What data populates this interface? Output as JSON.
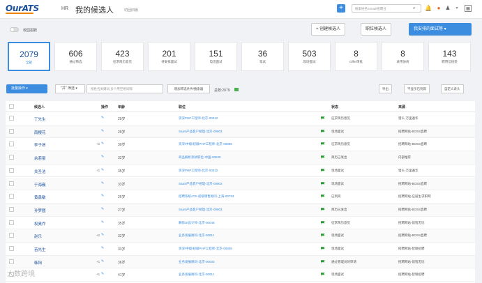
{
  "header": {
    "logo": "OurATS",
    "hr": "HR",
    "title": "我的候选人",
    "switch": "切回旧版",
    "search_placeholder": "搜索姓名/email/招聘台"
  },
  "toggle_label": "校园招聘",
  "buttons": {
    "create": "+ 创建候选人",
    "job": "职位候选人",
    "interview": "我安排的面试等 ▾"
  },
  "stats": [
    {
      "n": "2079",
      "l": "全部"
    },
    {
      "n": "606",
      "l": "通过筛选"
    },
    {
      "n": "423",
      "l": "征求简历意见"
    },
    {
      "n": "201",
      "l": "待安排面试"
    },
    {
      "n": "151",
      "l": "电话面试"
    },
    {
      "n": "36",
      "l": "笔试"
    },
    {
      "n": "503",
      "l": "现场面试"
    },
    {
      "n": "8",
      "l": "Offer审批"
    },
    {
      "n": "8",
      "l": "录用协商"
    },
    {
      "n": "143",
      "l": "聘用信接受"
    }
  ],
  "toolbar": {
    "bulk": "批量操作 ▾",
    "filter": "\"并\" 筛选 ▾",
    "filter_placeholder": "按姓名关键词,多个用空格间隔",
    "add_filter": "增加筛选条件/搜索器",
    "total": "总数:2079",
    "export": "导出",
    "no_show": "不显示已到岗",
    "custom": "自定义表头"
  },
  "columns": {
    "name": "候选人",
    "op": "操作",
    "age": "年龄",
    "job": "职位",
    "status": "状态",
    "source": "来源"
  },
  "rows": [
    {
      "name": "丁先生",
      "op": "",
      "age": "29岁",
      "job": "资深PHP工程师-北京-00012",
      "status": "征求简历意见",
      "src": "猎头-万里遍华"
    },
    {
      "name": "南樱花",
      "op": "",
      "age": "29岁",
      "job": "SaaS产品客户经理-北京-00903",
      "status": "现场面试",
      "src": "招聘网站-BOSS直聘"
    },
    {
      "name": "李子昂",
      "op": "+2",
      "age": "30岁",
      "job": "资深/中级/初级PHP工程师-北京-00808",
      "status": "征求简历意见",
      "src": "招聘网站-BOSS直聘"
    },
    {
      "name": "余若豪",
      "op": "",
      "age": "32岁",
      "job": "商品解析测试职位-中国-00830",
      "status": "简历已发出",
      "src": "内部推荐"
    },
    {
      "name": "关圣洁",
      "op": "+1",
      "age": "35岁",
      "job": "资深PHP工程师-北京-00012",
      "status": "现场面试",
      "src": "猎头-万里遍华"
    },
    {
      "name": "于海巍",
      "op": "",
      "age": "33岁",
      "job": "SaaS产品客户经理-北京-00903",
      "status": "现场面试",
      "src": "招聘网站-BOSS直聘"
    },
    {
      "name": "黄鑫敏",
      "op": "",
      "age": "26岁",
      "job": "招聘系统ATS-初级销售顾问-上海-00793",
      "status": "已到岗",
      "src": "招聘网站-应届生求职网"
    },
    {
      "name": "孙梦圆",
      "op": "",
      "age": "27岁",
      "job": "SaaS产品客户经理-北京-00903",
      "status": "简历已发出",
      "src": "招聘网站-BOSS直聘"
    },
    {
      "name": "权奥乔",
      "op": "",
      "age": "35岁",
      "job": "舞际UI设计师-北京-00048",
      "status": "征求简历意见",
      "src": "招聘网站-前程无忧"
    },
    {
      "name": "赵乐",
      "op": "+2",
      "age": "32岁",
      "job": "业务发展顾问-北京-00811",
      "status": "现场面试",
      "src": "招聘网站-BOSS直聘"
    },
    {
      "name": "苗先生",
      "op": "",
      "age": "33岁",
      "job": "资深/中级/初级PHP工程师-北京-00808",
      "status": "现场面试",
      "src": "招聘网站-智联招聘"
    },
    {
      "name": "韩阳",
      "op": "+1",
      "age": "36岁",
      "job": "业务发展顾问-北京-00003",
      "status": "通过管理员的审请",
      "src": "招聘网站-前程无忧"
    },
    {
      "name": "",
      "op": "+1",
      "age": "41岁",
      "job": "业务发展顾问-北京-00811",
      "status": "现场面试",
      "src": "招聘网站-智联招聘"
    }
  ],
  "watermark": "大数跨境"
}
